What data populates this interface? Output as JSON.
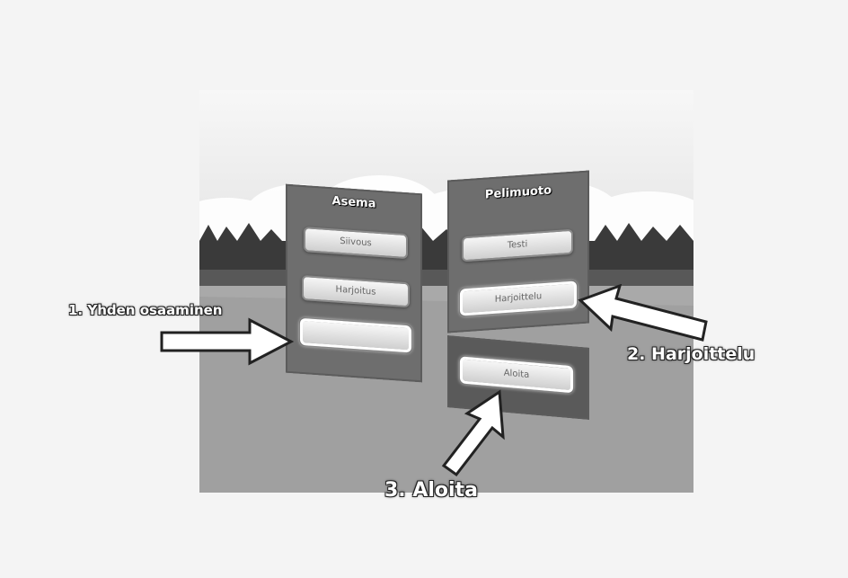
{
  "panels": {
    "left": {
      "title": "Asema",
      "buttons": [
        "Siivous",
        "Harjoitus",
        ""
      ]
    },
    "right": {
      "title": "Pelimuoto",
      "buttons": [
        "Testi",
        "Harjoittelu"
      ]
    },
    "start": {
      "button": "Aloita"
    }
  },
  "annotations": {
    "step1": "1. Yhden osaaminen",
    "step2": "2. Harjoittelu",
    "step3": "3. Aloita"
  }
}
